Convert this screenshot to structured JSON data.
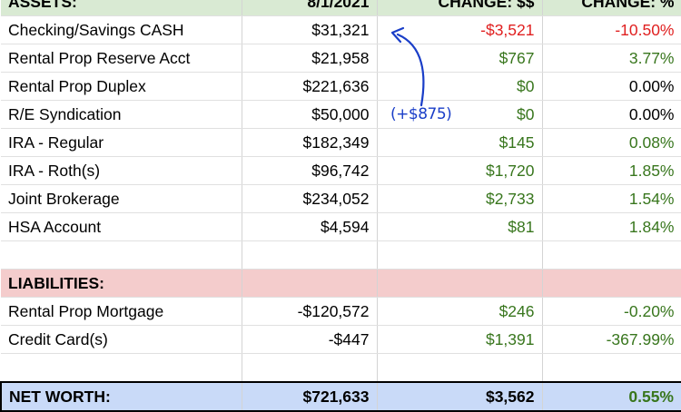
{
  "header": {
    "col1": "ASSETS:",
    "col2": "8/1/2021",
    "col3": "CHANGE: $$",
    "col4": "CHANGE: %"
  },
  "assets": [
    {
      "name": "Checking/Savings CASH",
      "value": "$31,321",
      "change": "-$3,521",
      "pct": "-10.50%",
      "change_color": "neg",
      "pct_color": "neg"
    },
    {
      "name": "Rental Prop Reserve Acct",
      "value": "$21,958",
      "change": "$767",
      "pct": "3.77%",
      "change_color": "pos",
      "pct_color": "pos"
    },
    {
      "name": "Rental Prop Duplex",
      "value": "$221,636",
      "change": "$0",
      "pct": "0.00%",
      "change_color": "pos",
      "pct_color": ""
    },
    {
      "name": "R/E Syndication",
      "value": "$50,000",
      "change": "$0",
      "pct": "0.00%",
      "change_color": "pos",
      "pct_color": ""
    },
    {
      "name": "IRA - Regular",
      "value": "$182,349",
      "change": "$145",
      "pct": "0.08%",
      "change_color": "pos",
      "pct_color": "pos"
    },
    {
      "name": "IRA - Roth(s)",
      "value": "$96,742",
      "change": "$1,720",
      "pct": "1.85%",
      "change_color": "pos",
      "pct_color": "pos"
    },
    {
      "name": "Joint Brokerage",
      "value": "$234,052",
      "change": "$2,733",
      "pct": "1.54%",
      "change_color": "pos",
      "pct_color": "pos"
    },
    {
      "name": "HSA Account",
      "value": "$4,594",
      "change": "$81",
      "pct": "1.84%",
      "change_color": "pos",
      "pct_color": "pos"
    }
  ],
  "liabilities_label": "LIABILITIES:",
  "liabilities": [
    {
      "name": "Rental Prop Mortgage",
      "value": "-$120,572",
      "change": "$246",
      "pct": "-0.20%",
      "change_color": "pos",
      "pct_color": "pos"
    },
    {
      "name": "Credit Card(s)",
      "value": "-$447",
      "change": "$1,391",
      "pct": "-367.99%",
      "change_color": "pos",
      "pct_color": "pos"
    }
  ],
  "net_worth": {
    "label": "NET WORTH:",
    "value": "$721,633",
    "change": "$3,562",
    "pct": "0.55%"
  },
  "annotation": {
    "text": "(+$875)",
    "color": "#1a3ec8"
  },
  "colors": {
    "assets_header": "#d9ead3",
    "liabilities_header": "#f4cccc",
    "net_worth_row": "#c9daf8",
    "negative": "#e02020",
    "positive": "#38761d"
  }
}
